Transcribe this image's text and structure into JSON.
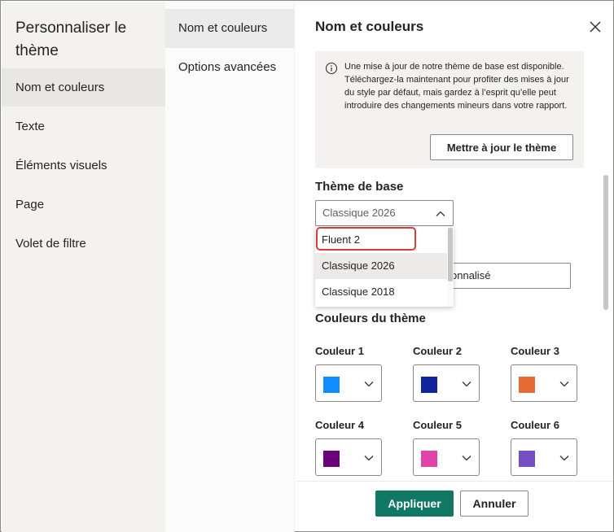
{
  "left_nav": {
    "title": "Personnaliser le thème",
    "items": [
      {
        "label": "Nom et couleurs",
        "active": true
      },
      {
        "label": "Texte",
        "active": false
      },
      {
        "label": "Éléments visuels",
        "active": false
      },
      {
        "label": "Page",
        "active": false
      },
      {
        "label": "Volet de filtre",
        "active": false
      }
    ]
  },
  "sub_nav": {
    "items": [
      {
        "label": "Nom et couleurs",
        "active": true
      },
      {
        "label": "Options avancées",
        "active": false
      }
    ]
  },
  "content": {
    "title": "Nom et couleurs",
    "info": {
      "text": "Une mise à jour de notre thème de base est disponible. Téléchargez-la maintenant pour profiter des mises à jour du style par défaut, mais gardez à l’esprit qu’elle peut introduire des changements mineurs dans votre rapport.",
      "button_label": "Mettre à jour le thème"
    },
    "base_theme": {
      "label": "Thème de base",
      "selected": "Classique 2026",
      "options": [
        "Fluent 2",
        "Classique 2026",
        "Classique 2018"
      ]
    },
    "name_input_partial": "onnalisé",
    "theme_colors": {
      "label": "Couleurs du thème",
      "colors": [
        {
          "label": "Couleur 1",
          "hex": "#118DFF"
        },
        {
          "label": "Couleur 2",
          "hex": "#12239E"
        },
        {
          "label": "Couleur 3",
          "hex": "#E66C37"
        },
        {
          "label": "Couleur 4",
          "hex": "#6B007B"
        },
        {
          "label": "Couleur 5",
          "hex": "#E044A7"
        },
        {
          "label": "Couleur 6",
          "hex": "#744EC2"
        }
      ]
    }
  },
  "footer": {
    "apply_label": "Appliquer",
    "cancel_label": "Annuler"
  },
  "colors": {
    "accent": "#117865",
    "highlight": "#E03A3E"
  }
}
